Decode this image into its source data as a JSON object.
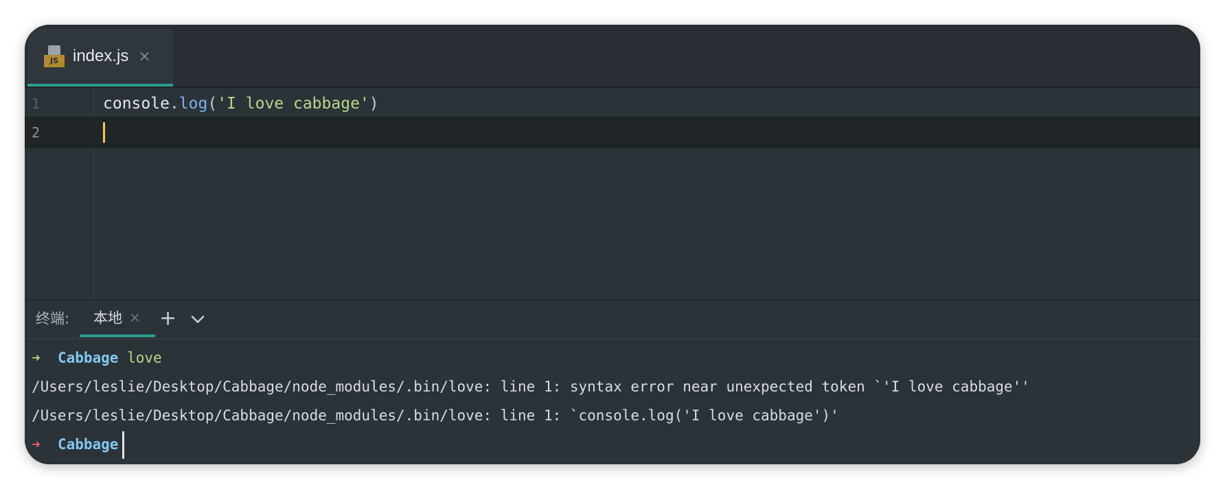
{
  "editor": {
    "tab": {
      "icon_text": "JS",
      "title": "index.js",
      "close": "×"
    },
    "lines": [
      {
        "number": "1",
        "tokens": {
          "object": "console",
          "dot": ".",
          "method": "log",
          "open_paren": "(",
          "string": "'I love cabbage'",
          "close_paren": ")"
        }
      },
      {
        "number": "2",
        "text": ""
      }
    ]
  },
  "terminal": {
    "label": "终端:",
    "tab_title": "本地",
    "tab_close": "×",
    "add_button": "+",
    "lines": [
      {
        "arrow": "➜",
        "dir": "Cabbage",
        "command": "love"
      },
      {
        "text": "/Users/leslie/Desktop/Cabbage/node_modules/.bin/love: line 1: syntax error near unexpected token `'I love cabbage''"
      },
      {
        "text": "/Users/leslie/Desktop/Cabbage/node_modules/.bin/love: line 1: `console.log('I love cabbage')'"
      },
      {
        "arrow": "➜",
        "dir": "Cabbage"
      }
    ]
  },
  "colors": {
    "background": "#2b3238",
    "accent_tab_underline": "#2a9d8f",
    "caret": "#f2c94c",
    "prompt_ok": "#a6d47a",
    "prompt_error": "#ef5a6f",
    "directory": "#82c8f0",
    "string": "#b8d78a",
    "method": "#7fb0e8"
  }
}
